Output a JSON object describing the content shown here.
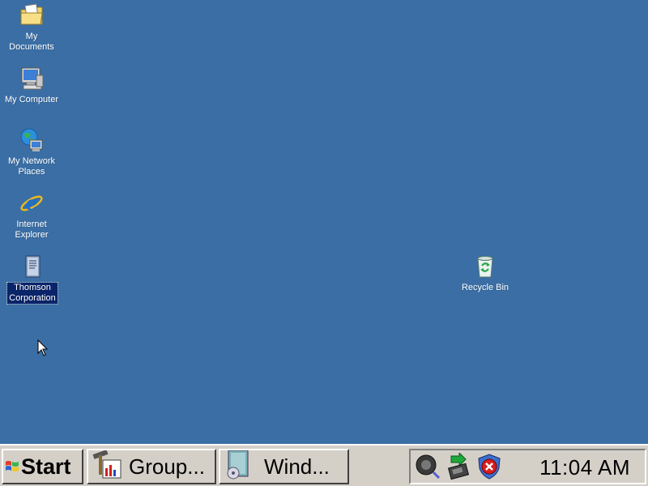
{
  "desktop": {
    "background_color": "#3a6ea5",
    "icons": [
      {
        "label": "My Documents",
        "icon": "folder-documents-icon"
      },
      {
        "label": "My Computer",
        "icon": "computer-icon"
      },
      {
        "label_line1": "My Network",
        "label_line2": "Places",
        "icon": "network-globe-icon"
      },
      {
        "label_line1": "Internet",
        "label_line2": "Explorer",
        "icon": "internet-explorer-icon"
      },
      {
        "label_line1": "Thomson",
        "label_line2": "Corporation",
        "icon": "document-icon",
        "selected": true
      },
      {
        "label": "Recycle Bin",
        "icon": "recycle-bin-icon"
      }
    ]
  },
  "taskbar": {
    "start_label": "Start",
    "tasks": [
      {
        "label": "Group...",
        "icon": "tools-window-icon"
      },
      {
        "label": "Wind...",
        "icon": "installer-icon"
      }
    ],
    "tray_icons": [
      "speaker-icon",
      "network-connection-icon",
      "security-shield-icon"
    ],
    "clock": "11:04 AM"
  }
}
